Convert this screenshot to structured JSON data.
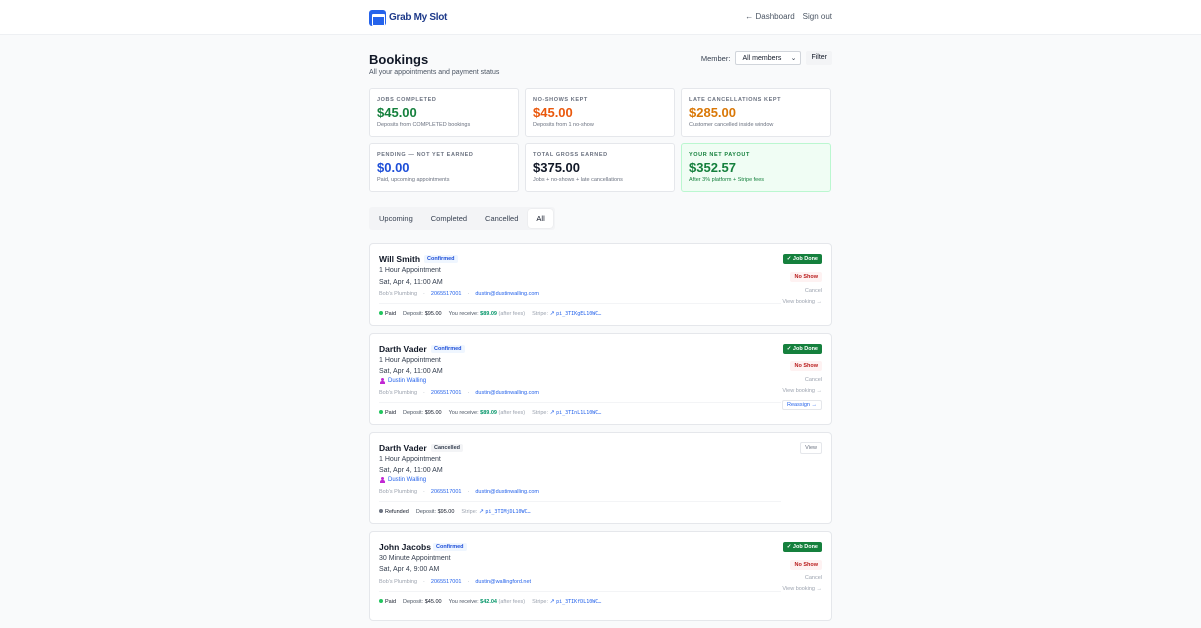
{
  "app": {
    "brand": "Grab My Slot"
  },
  "nav": {
    "dashboard": "← Dashboard",
    "signout": "Sign out"
  },
  "page": {
    "title": "Bookings",
    "subtitle": "All your appointments and payment status"
  },
  "member_filter": {
    "label": "Member:",
    "selected": "All members",
    "filter_label": "Filter"
  },
  "stats": [
    {
      "label": "JOBS COMPLETED",
      "value": "$45.00",
      "note": "Deposits from COMPLETED bookings",
      "color": "#15803d"
    },
    {
      "label": "NO-SHOWS KEPT",
      "value": "$45.00",
      "note": "Deposits from 1 no-show",
      "color": "#ea580c"
    },
    {
      "label": "LATE CANCELLATIONS KEPT",
      "value": "$285.00",
      "note": "Customer cancelled inside window",
      "color": "#d97706"
    },
    {
      "label": "PENDING — NOT YET EARNED",
      "value": "$0.00",
      "note": "Paid, upcoming appointments",
      "color": "#1d4ed8"
    },
    {
      "label": "TOTAL GROSS EARNED",
      "value": "$375.00",
      "note": "Jobs + no-shows + late cancellations",
      "color": "#111827"
    },
    {
      "label": "YOUR NET PAYOUT",
      "value": "$352.57",
      "note": "After 3% platform + Stripe fees",
      "color": "#15803d"
    }
  ],
  "tabs": [
    "Upcoming",
    "Completed",
    "Cancelled",
    "All"
  ],
  "active_tab": "All",
  "labels": {
    "deposit": "Deposit:",
    "you_receive": "You receive:",
    "after_fees": "(after fees)",
    "stripe": "Stripe:",
    "job_done": "✓ Job Done",
    "no_show": "No Show",
    "cancel": "Cancel",
    "view_booking": "View booking →",
    "reassign": "Reassign →",
    "view": "View"
  },
  "bookings": [
    {
      "name": "Will Smith",
      "status": "Confirmed",
      "service": "1 Hour Appointment",
      "datetime": "Sat, Apr 4, 11:00 AM",
      "business": "Bob's Plumbing",
      "phone": "2065517001",
      "email": "dustin@dustinwalling.com",
      "pay_status": "Paid",
      "deposit": "$95.00",
      "receive": "$89.09",
      "stripe_id": "pi_3TIKgEL10WC…"
    },
    {
      "name": "Darth Vader",
      "status": "Confirmed",
      "service": "1 Hour Appointment",
      "datetime": "Sat, Apr 4, 11:00 AM",
      "assignee": "Dustin Walling",
      "business": "Bob's Plumbing",
      "phone": "2065517001",
      "email": "dustin@dustinwalling.com",
      "pay_status": "Paid",
      "deposit": "$95.00",
      "receive": "$89.09",
      "stripe_id": "pi_3TInL1L10WC…"
    },
    {
      "name": "Darth Vader",
      "status": "Cancelled",
      "service": "1 Hour Appointment",
      "datetime": "Sat, Apr 4, 11:00 AM",
      "assignee": "Dustin Walling",
      "business": "Bob's Plumbing",
      "phone": "2065517001",
      "email": "dustin@dustinwalling.com",
      "pay_status": "Refunded",
      "deposit": "$95.00",
      "stripe_id": "pi_3TIMjDL10WC…"
    },
    {
      "name": "John Jacobs",
      "status": "Confirmed",
      "service": "30 Minute Appointment",
      "datetime": "Sat, Apr 4, 9:00 AM",
      "business": "Bob's Plumbing",
      "phone": "2065517001",
      "email": "dustin@wallingford.net",
      "pay_status": "Paid",
      "deposit": "$45.00",
      "receive": "$42.04",
      "stripe_id": "pi_3TIKfDL10WC…"
    }
  ]
}
